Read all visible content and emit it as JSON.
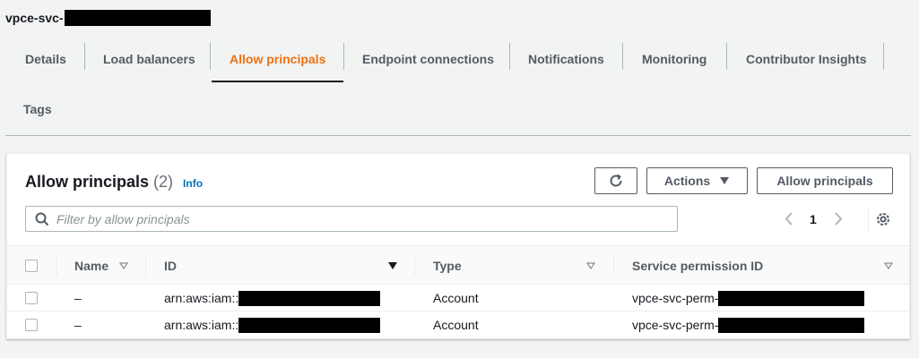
{
  "page": {
    "title": "vpce-svc-"
  },
  "tabs": [
    {
      "label": "Details",
      "active": false
    },
    {
      "label": "Load balancers",
      "active": false
    },
    {
      "label": "Allow principals",
      "active": true
    },
    {
      "label": "Endpoint connections",
      "active": false
    },
    {
      "label": "Notifications",
      "active": false
    },
    {
      "label": "Monitoring",
      "active": false
    },
    {
      "label": "Contributor Insights",
      "active": false
    },
    {
      "label": "Tags",
      "active": false
    }
  ],
  "panel": {
    "title": "Allow principals",
    "count": "(2)",
    "info": "Info",
    "actions_label": "Actions",
    "allow_button_label": "Allow principals",
    "refresh_icon": "refresh-icon",
    "search_placeholder": "Filter by allow principals",
    "page_number": "1"
  },
  "table": {
    "columns": [
      "Name",
      "ID",
      "Type",
      "Service permission ID"
    ],
    "rows": [
      {
        "name": "–",
        "id": "arn:aws:iam::",
        "type": "Account",
        "permission_id": "vpce-svc-perm-"
      },
      {
        "name": "–",
        "id": "arn:aws:iam::",
        "type": "Account",
        "permission_id": "vpce-svc-perm-"
      }
    ]
  },
  "colors": {
    "accent": "#ec7211",
    "link": "#0073bb",
    "text": "#16191f",
    "muted": "#545b64"
  }
}
